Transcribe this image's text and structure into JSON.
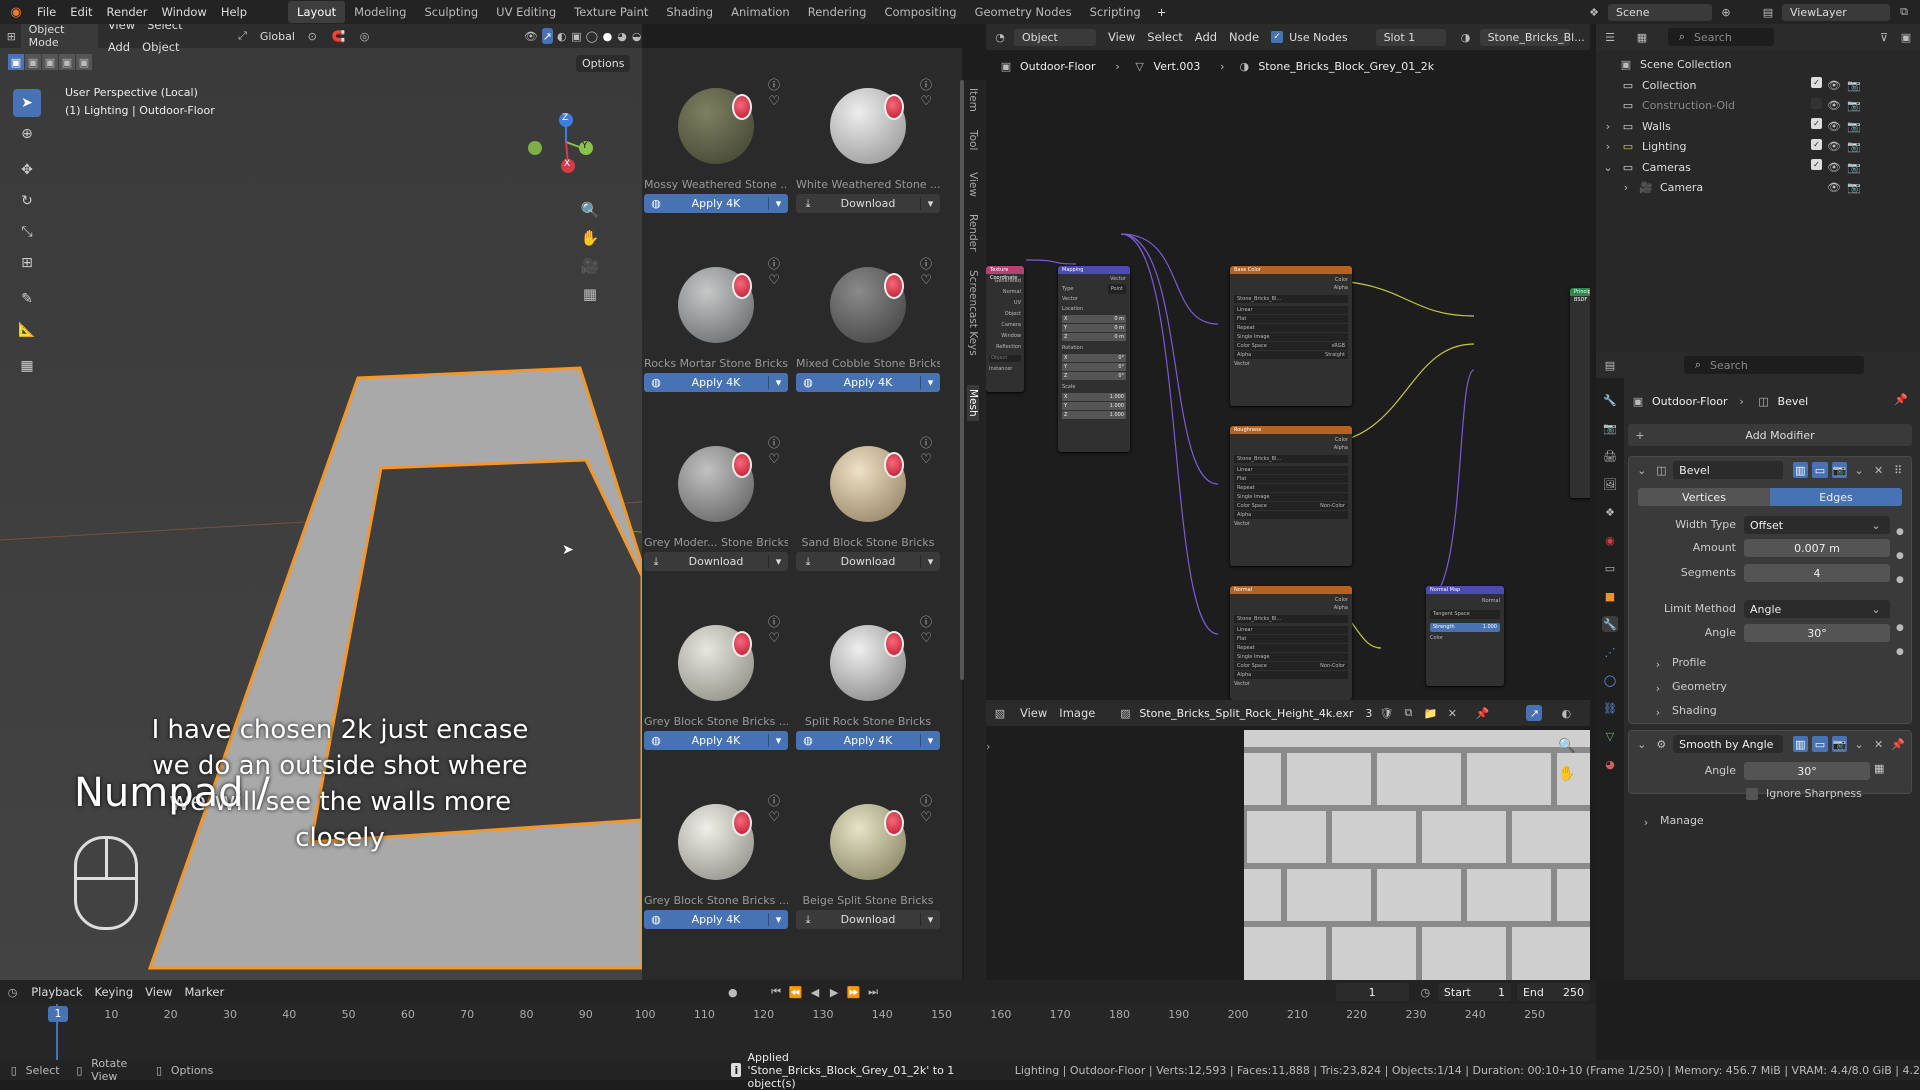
{
  "menubar": {
    "menus": [
      "File",
      "Edit",
      "Render",
      "Window",
      "Help"
    ],
    "workspaces": [
      "Layout",
      "Modeling",
      "Sculpting",
      "UV Editing",
      "Texture Paint",
      "Shading",
      "Animation",
      "Rendering",
      "Compositing",
      "Geometry Nodes",
      "Scripting"
    ],
    "active_workspace": "Layout",
    "scene": "Scene",
    "view_layer": "ViewLayer"
  },
  "viewport": {
    "mode": "Object Mode",
    "menus": [
      "View",
      "Select",
      "Add",
      "Object"
    ],
    "transform": "Global",
    "options": "Options",
    "info_line1": "User Perspective (Local)",
    "info_line2": "(1) Lighting | Outdoor-Floor",
    "subtitle_line1": "I have chosen 2k just encase",
    "subtitle_line2": "we do an outside shot where",
    "subtitle_line3": "we will see the walls more closely",
    "key_overlay": "Numpad /",
    "gizmo": {
      "z": "Z",
      "y": "Y",
      "x": "X"
    }
  },
  "sidebar_tabs": [
    "Item",
    "Tool",
    "View",
    "Render",
    "Screencast Keys",
    "Mesh"
  ],
  "assets": [
    {
      "name": "Mossy Weathered Stone ...",
      "action": "Apply 4K",
      "type": "apply",
      "c1": "#7e8062",
      "c2": "#3e3f2c"
    },
    {
      "name": "White Weathered Stone ...",
      "action": "Download",
      "type": "dl",
      "c1": "#eeeeee",
      "c2": "#8d8d8d"
    },
    {
      "name": "Rocks Mortar Stone Bricks",
      "action": "Apply 4K",
      "type": "apply",
      "c1": "#c6c8c8",
      "c2": "#5d6063"
    },
    {
      "name": "Mixed Cobble Stone Bricks",
      "action": "Apply 4K",
      "type": "apply",
      "c1": "#8a8a8a",
      "c2": "#3c3c3c"
    },
    {
      "name": "Grey Moder... Stone Bricks",
      "action": "Download",
      "type": "dl",
      "c1": "#c2c2c2",
      "c2": "#585858"
    },
    {
      "name": "Sand Block Stone Bricks",
      "action": "Download",
      "type": "dl",
      "c1": "#efe1c6",
      "c2": "#8a7758"
    },
    {
      "name": "Grey Block Stone Bricks ...",
      "action": "Apply 4K",
      "type": "apply",
      "c1": "#e7e6df",
      "c2": "#84847a"
    },
    {
      "name": "Split Rock Stone Bricks",
      "action": "Apply 4K",
      "type": "apply",
      "c1": "#efefef",
      "c2": "#7a7a7a"
    },
    {
      "name": "Grey Block Stone Bricks ...",
      "action": "Apply 4K",
      "type": "apply",
      "c1": "#efeee8",
      "c2": "#86857c"
    },
    {
      "name": "Beige Split Stone Bricks",
      "action": "Download",
      "type": "dl",
      "c1": "#e6e3c7",
      "c2": "#7b7755"
    }
  ],
  "node_editor": {
    "mode": "Object",
    "menus": [
      "View",
      "Select",
      "Add",
      "Node"
    ],
    "use_nodes": "Use Nodes",
    "slot": "Slot 1",
    "material": "Stone_Bricks_Bl...",
    "breadcrumb": [
      "Outdoor-Floor",
      "Vert.003",
      "Stone_Bricks_Block_Grey_01_2k"
    ],
    "nodes": {
      "texcoord": "Texture Coordinate",
      "mapping": "Mapping",
      "basecolor": "Base Color",
      "roughness": "Roughness",
      "normal": "Normal",
      "normalmap": "Normal Map",
      "bsdf": "Principled BSDF",
      "img_name": "Stone_Bricks_Bl...",
      "rows": [
        "Linear",
        "Flat",
        "Repeat",
        "Single Image",
        "Color Space",
        "Alpha"
      ],
      "cs_srgb": "sRGB",
      "cs_noncolor": "Non-Color",
      "alpha_straight": "Straight",
      "vector": "Vector",
      "color": "Color",
      "alpha": "Alpha",
      "texcoord_outputs": [
        "Generated",
        "Normal",
        "UV",
        "Object",
        "Camera",
        "Window",
        "Reflection"
      ],
      "texcoord_object": "Object",
      "texcoord_instancer": "Instancer",
      "mapping_type_label": "Type",
      "mapping_type": "Point",
      "mapping_vector": "Vector",
      "mapping_location": "Location",
      "mapping_rotation": "Rotation",
      "mapping_scale": "Scale",
      "loc_vals": [
        "0 m",
        "0 m",
        "0 m"
      ],
      "rot_vals": [
        "0°",
        "0°",
        "0°"
      ],
      "scale_vals": [
        "1.000",
        "1.000",
        "1.000"
      ],
      "axes": [
        "X",
        "Y",
        "Z"
      ],
      "nm_tangent": "Tangent Space",
      "nm_strength": "Strength",
      "nm_strength_val": "1.000",
      "nm_normal": "Normal",
      "nm_color": "Color"
    }
  },
  "image_editor": {
    "menus": [
      "View",
      "Image"
    ],
    "image": "Stone_Bricks_Split_Rock_Height_4k.exr",
    "users": "3"
  },
  "outliner": {
    "search": "Search",
    "root": "Scene Collection",
    "items": [
      {
        "name": "Collection",
        "indent": 0
      },
      {
        "name": "Construction-Old",
        "indent": 0
      },
      {
        "name": "Walls",
        "indent": 0
      },
      {
        "name": "Lighting",
        "indent": 0
      },
      {
        "name": "Cameras",
        "indent": 0
      },
      {
        "name": "Camera",
        "indent": 1
      }
    ]
  },
  "properties": {
    "search": "Search",
    "breadcrumb_object": "Outdoor-Floor",
    "breadcrumb_modifier": "Bevel",
    "add_modifier": "Add Modifier",
    "bevel": {
      "name": "Bevel",
      "tabs": [
        "Vertices",
        "Edges"
      ],
      "active_tab": "Edges",
      "width_type_label": "Width Type",
      "width_type": "Offset",
      "amount_label": "Amount",
      "amount": "0.007 m",
      "segments_label": "Segments",
      "segments": "4",
      "limit_method_label": "Limit Method",
      "limit_method": "Angle",
      "angle_label": "Angle",
      "angle": "30°",
      "subpanels": [
        "Profile",
        "Geometry",
        "Shading"
      ]
    },
    "smooth": {
      "name": "Smooth by Angle",
      "angle_label": "Angle",
      "angle": "30°",
      "ignore_sharpness": "Ignore Sharpness",
      "manage": "Manage"
    }
  },
  "timeline": {
    "menus": [
      "Playback",
      "Keying",
      "View",
      "Marker"
    ],
    "current_frame": "1",
    "start_label": "Start",
    "start": "1",
    "end_label": "End",
    "end": "250",
    "ticks": [
      "1",
      "10",
      "20",
      "30",
      "40",
      "50",
      "60",
      "70",
      "80",
      "90",
      "100",
      "110",
      "120",
      "130",
      "140",
      "150",
      "160",
      "170",
      "180",
      "190",
      "200",
      "210",
      "220",
      "230",
      "240",
      "250"
    ]
  },
  "statusbar": {
    "select": "Select",
    "rotate": "Rotate View",
    "options": "Options",
    "message": "Applied 'Stone_Bricks_Block_Grey_01_2k' to 1 object(s)",
    "stats": "Lighting | Outdoor-Floor | Verts:12,593 | Faces:11,888 | Tris:23,824 | Objects:1/14 | Duration: 00:10+10 (Frame 1/250) | Memory: 456.7 MiB | VRAM: 4.4/8.0 GiB | 4.2"
  }
}
